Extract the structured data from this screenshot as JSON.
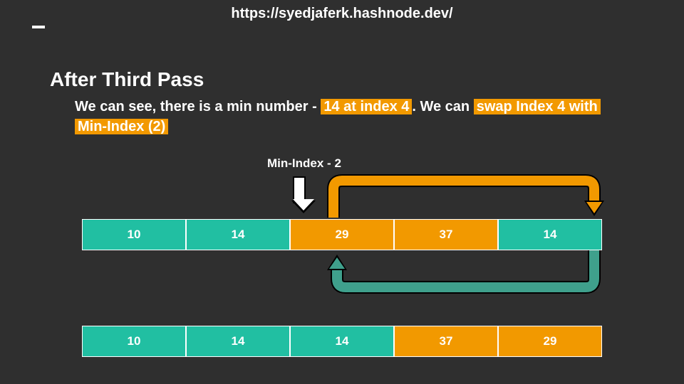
{
  "url": "https://syedjaferk.hashnode.dev/",
  "title": "After Third Pass",
  "desc": {
    "pre": "We can see, there is a min number - ",
    "chip1": "14 at index 4",
    "mid": ". We can ",
    "chip2": "swap Index 4 with",
    "post": " ",
    "chip3": "Min-Index (2)"
  },
  "min_label": "Min-Index - 2",
  "row1": [
    {
      "v": "10",
      "c": "teal"
    },
    {
      "v": "14",
      "c": "teal"
    },
    {
      "v": "29",
      "c": "orange"
    },
    {
      "v": "37",
      "c": "orange"
    },
    {
      "v": "14",
      "c": "teal"
    }
  ],
  "row2": [
    {
      "v": "10",
      "c": "teal"
    },
    {
      "v": "14",
      "c": "teal"
    },
    {
      "v": "14",
      "c": "teal"
    },
    {
      "v": "37",
      "c": "orange"
    },
    {
      "v": "29",
      "c": "orange"
    }
  ],
  "colors": {
    "teal": "#21BFA2",
    "orange": "#F29900",
    "bg": "#2f2f2f"
  }
}
